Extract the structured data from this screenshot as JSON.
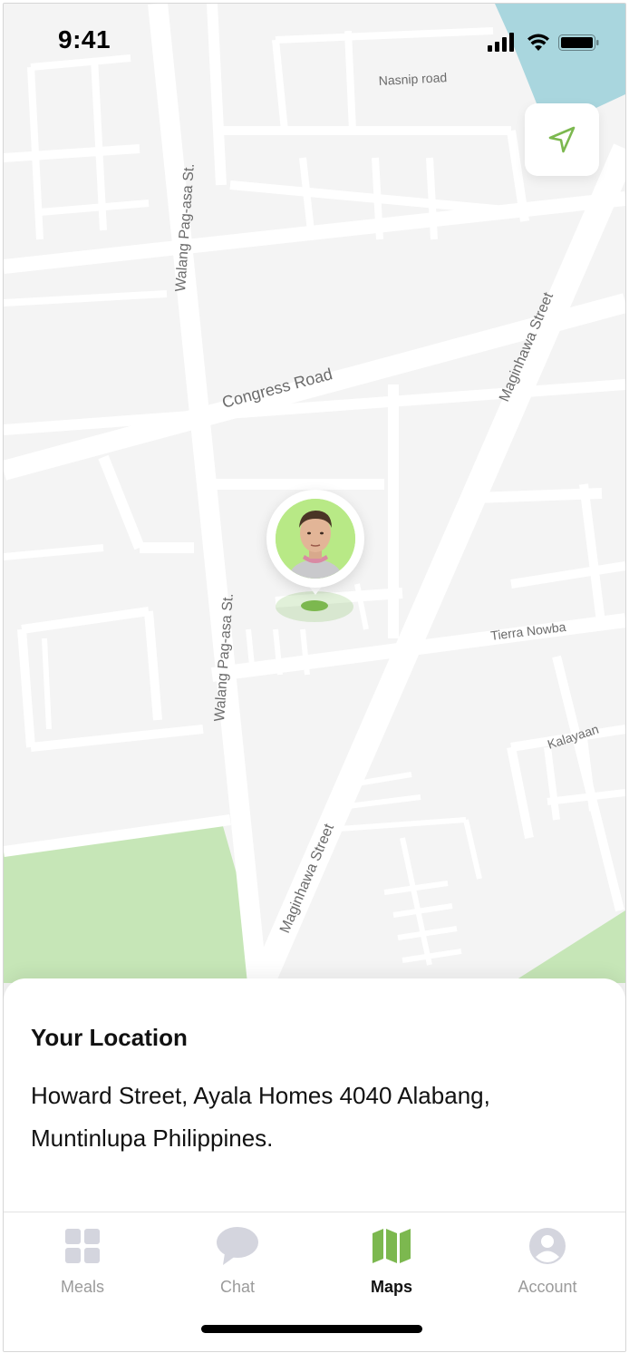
{
  "status_bar": {
    "time": "9:41"
  },
  "map": {
    "road_labels": {
      "nasnip": "Nasnip road",
      "walang_top": "Walang Pag-asa St.",
      "congress": "Congress Road",
      "maginhawa_top": "Maginhawa Street",
      "walang_bottom": "Walang Pag-asa St.",
      "tierra": "Tierra Nowba",
      "kalayaan": "Kalayaan",
      "maginhawa_bottom": "Maginhawa Street"
    },
    "locate_icon": "navigation-arrow-icon",
    "pin_avatar": "user-avatar"
  },
  "location_sheet": {
    "title": "Your Location",
    "address_line1": "Howard Street, Ayala Homes 4040 Alabang,",
    "address_line2": "Muntinlupa Philippines."
  },
  "tabbar": {
    "tabs": [
      {
        "label": "Meals",
        "icon": "grid-icon"
      },
      {
        "label": "Chat",
        "icon": "chat-bubble-icon"
      },
      {
        "label": "Maps",
        "icon": "map-icon"
      },
      {
        "label": "Account",
        "icon": "account-icon"
      }
    ],
    "active": "Maps"
  },
  "colors": {
    "accent": "#7cb84f",
    "park": "#c6e6b7",
    "water": "#a9d6de",
    "map_bg": "#f4f4f4",
    "road": "#ffffff",
    "inactive": "#9b9b9b"
  }
}
